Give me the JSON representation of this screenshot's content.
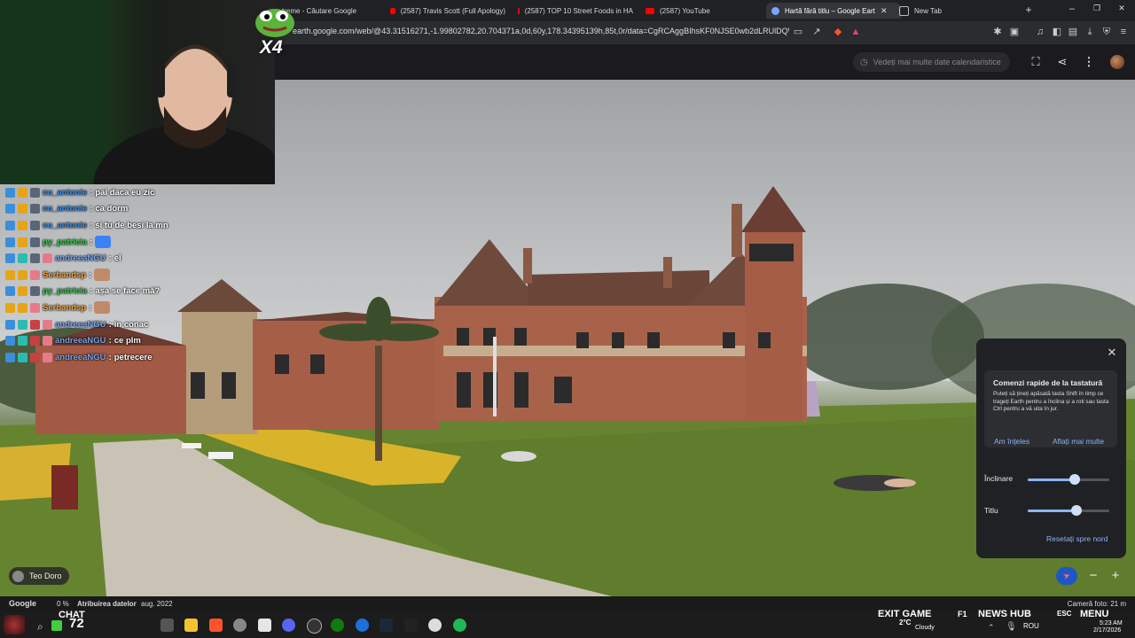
{
  "browser": {
    "tabs": [
      {
        "label": "treme - Căutare Google",
        "icon": "google-icon"
      },
      {
        "label": "(2587) Travis Scott (Full Apology)",
        "icon": "youtube-icon"
      },
      {
        "label": "(2587) TOP 10 Street Foods in HA",
        "icon": "youtube-icon"
      },
      {
        "label": "(2587) YouTube",
        "icon": "youtube-icon"
      },
      {
        "label": "Hartă fără titlu – Google Earth",
        "icon": "earth-icon",
        "active": true
      },
      {
        "label": "New Tab",
        "icon": "shield-icon"
      }
    ],
    "new_tab": "+",
    "window_controls": {
      "minimize": "–",
      "maximize": "❐",
      "close": "✕"
    },
    "url": "earth.google.com/web/@43.31516271,-1.99802782,20.704371a,0d,60y,178.34395139h,85t,0r/data=CgRCAggBIhsKF0NJSE0wb2dLRUlDQWdJQ3..."
  },
  "earth": {
    "calendar_pill": "Vedeți mai multe date calendaristice",
    "toolbar_icons": [
      "fullscreen-icon",
      "share-icon",
      "more-icon",
      "profile-avatar"
    ]
  },
  "overlay": {
    "multiplier": "X4"
  },
  "chat": [
    {
      "user": "cu_antonie",
      "text": "pai daca eu zic",
      "color": "#3b8fe0",
      "emote": false
    },
    {
      "user": "cu_antonie",
      "text": "ca dorm",
      "color": "#3b8fe0",
      "emote": false
    },
    {
      "user": "cu_antonie",
      "text": "si tu de besi la mn",
      "color": "#3b8fe0",
      "emote": false
    },
    {
      "user": "py_patricia",
      "text": "",
      "color": "#35c94a",
      "emote": true
    },
    {
      "user": "andreeaNGU",
      "text": "el",
      "color": "#7aa3e8",
      "emote": false
    },
    {
      "user": "Serbandsp",
      "text": "",
      "color": "#f2a23a",
      "emote": true
    },
    {
      "user": "py_patricia",
      "text": "așa se face mă?",
      "color": "#35c94a",
      "emote": false
    },
    {
      "user": "Serbandsp",
      "text": "",
      "color": "#f2a23a",
      "emote": true
    },
    {
      "user": "andreeaNGU",
      "text": "în conac",
      "color": "#7aa3e8",
      "emote": false
    },
    {
      "user": "andreeaNGU",
      "text": "ce plm",
      "color": "#7aa3e8",
      "emote": false
    },
    {
      "user": "andreeaNGU",
      "text": "petrecere",
      "color": "#7aa3e8",
      "emote": false
    }
  ],
  "shortcuts_panel": {
    "title": "Comenzi rapide de la tastatură",
    "body": "Puteți să țineți apăsată tasta Shift în timp ce trageți Earth pentru a înclina și a roti sau tasta Ctrl pentru a vă uita în jur.",
    "got_it": "Am înțeles",
    "learn_more": "Aflați mai multe",
    "tilt_label": "Înclinare",
    "tilt_value": 0.58,
    "heading_label": "Titlu",
    "heading_value": 0.6,
    "reset_north": "Resetați spre nord"
  },
  "map_controls": {
    "zoom_out": "−",
    "zoom_in": "+"
  },
  "photographer": "Teo Doro",
  "status": {
    "google": "Google",
    "zoom": "0 %",
    "attribution": "Atribuirea datelor",
    "date": "aug. 2022",
    "camera": "Cameră foto: 21 m"
  },
  "taskbar": {
    "chat_label": "CHAT",
    "chat_count": "72",
    "exit_game": "EXIT GAME",
    "f1": "F1",
    "news_hub": "NEWS HUB",
    "esc": "ESC",
    "menu": "MENU",
    "temp": "2°C",
    "weather": "Cloudy",
    "lang": "ROU",
    "time": "5:23 AM",
    "date": "2/17/2026"
  },
  "colors": {
    "accent": "#8ab4f8",
    "compass": "#1e56c7",
    "youtube": "#ff0000"
  }
}
